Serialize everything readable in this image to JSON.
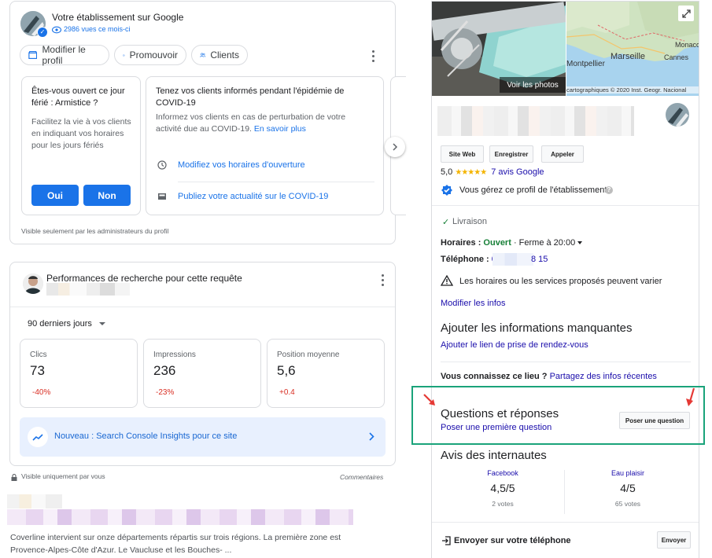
{
  "profile": {
    "title": "Votre établissement sur Google",
    "views": "2986 vues ce mois-ci",
    "buttons": {
      "edit": "Modifier le profil",
      "promote": "Promouvoir",
      "clients": "Clients"
    }
  },
  "holiday_card": {
    "question": "Êtes-vous ouvert ce jour férié : Armistice ?",
    "body": "Facilitez la vie à vos clients en indiquant vos horaires pour les jours fériés",
    "yes": "Oui",
    "no": "Non"
  },
  "covid_card": {
    "title": "Tenez vos clients informés pendant l'épidémie de COVID-19",
    "body": "Informez vos clients en cas de perturbation de votre activité due au COVID-19.",
    "learn_more": "En savoir plus",
    "action_hours": "Modifiez vos horaires d'ouverture",
    "action_post": "Publiez votre actualité sur le COVID-19"
  },
  "admin_note": "Visible seulement par les administrateurs du profil",
  "performance": {
    "title": "Performances de recherche pour cette requête",
    "period": "90 derniers jours",
    "metrics": [
      {
        "label": "Clics",
        "value": "73",
        "change": "-40%"
      },
      {
        "label": "Impressions",
        "value": "236",
        "change": "-23%"
      },
      {
        "label": "Position moyenne",
        "value": "5,6",
        "change": "+0.4"
      }
    ],
    "insights": "Nouveau : Search Console Insights pour ce site",
    "visibility": "Visible uniquement par vous",
    "comments": "Commentaires"
  },
  "result_snippet": "Coverline intervient sur onze départements répartis sur trois régions. La première zone est Provence-Alpes-Côte d'Azur. Le Vaucluse et les Bouches- ...",
  "knowledge_panel": {
    "photos_label": "Voir les photos",
    "map_cities": [
      "Montpellier",
      "Marseille",
      "Cannes",
      "Monaco"
    ],
    "map_credit": "cartographiques © 2020 Inst. Geogr. Nacional",
    "buttons": {
      "website": "Site Web",
      "save": "Enregistrer",
      "call": "Appeler"
    },
    "rating": "5,0",
    "stars": "★★★★★",
    "reviews_link": "7 avis Google",
    "managed": "Vous gérez ce profil de l'établissement",
    "delivery": "Livraison",
    "hours_label": "Horaires :",
    "hours_status": "Ouvert",
    "hours_close": "· Ferme à 20:00",
    "phone_label": "Téléphone :",
    "phone_start": "0",
    "phone_end": "8 15",
    "warning": "Les horaires ou les services proposés peuvent varier",
    "edit_info": "Modifier les infos",
    "missing_title": "Ajouter les informations manquantes",
    "missing_link": "Ajouter le lien de prise de rendez-vous",
    "know_label": "Vous connaissez ce lieu ?",
    "know_link": "Partagez des infos récentes",
    "qa_title": "Questions et réponses",
    "qa_link": "Poser une première question",
    "qa_button": "Poser une question",
    "reviews_title": "Avis des internautes",
    "review_sources": [
      {
        "name": "Facebook",
        "score": "4,5/5",
        "votes": "2 votes"
      },
      {
        "name": "Eau plaisir",
        "score": "4/5",
        "votes": "65 votes"
      }
    ],
    "send_phone": "Envoyer sur votre téléphone",
    "send_button": "Envoyer"
  },
  "colors": {
    "accent": "#1a73e8",
    "highlight_box": "#1aa37a",
    "arrow": "#e53935",
    "star": "#f4b400",
    "open": "#188038"
  }
}
